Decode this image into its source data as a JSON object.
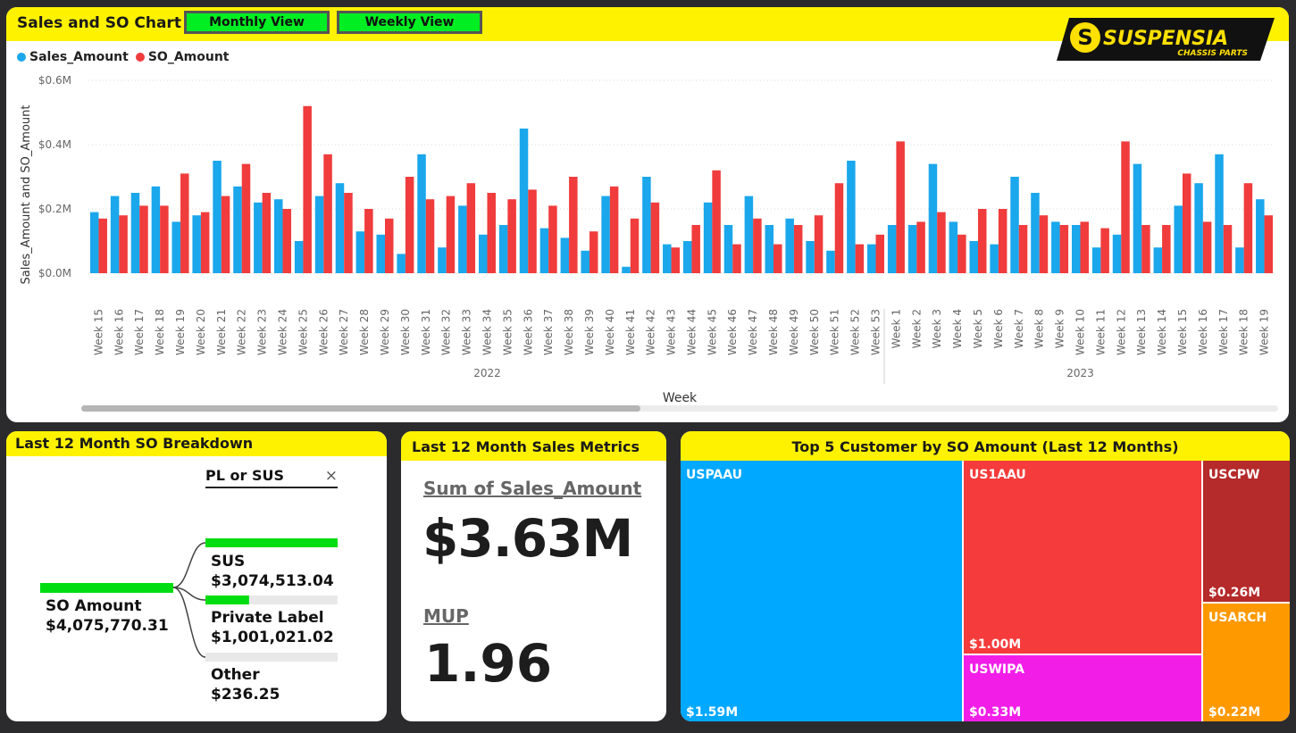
{
  "top": {
    "title": "Sales and SO Chart",
    "buttons": {
      "monthly": "Monthly View",
      "weekly": "Weekly View"
    },
    "logo": {
      "brand": "SUSPENSIA",
      "tagline": "CHASSIS PARTS"
    }
  },
  "chart_data": {
    "type": "bar",
    "title": "Sales and SO Chart",
    "xlabel": "Week",
    "ylabel": "Sales_Amount and SO_Amount",
    "ylim": [
      0,
      0.6
    ],
    "yticks": [
      "$0.0M",
      "$0.2M",
      "$0.4M",
      "$0.6M"
    ],
    "yunit": "$M",
    "grid": true,
    "legend_position": "top-left",
    "colors": {
      "Sales_Amount": "#1aa7ec",
      "SO_Amount": "#f03c3c"
    },
    "categories": [
      "Week 15",
      "Week 16",
      "Week 17",
      "Week 18",
      "Week 19",
      "Week 20",
      "Week 21",
      "Week 22",
      "Week 23",
      "Week 24",
      "Week 25",
      "Week 26",
      "Week 27",
      "Week 28",
      "Week 29",
      "Week 30",
      "Week 31",
      "Week 32",
      "Week 33",
      "Week 34",
      "Week 35",
      "Week 36",
      "Week 37",
      "Week 38",
      "Week 39",
      "Week 40",
      "Week 41",
      "Week 42",
      "Week 43",
      "Week 44",
      "Week 45",
      "Week 46",
      "Week 47",
      "Week 48",
      "Week 49",
      "Week 50",
      "Week 51",
      "Week 52",
      "Week 53",
      "Week 1",
      "Week 2",
      "Week 3",
      "Week 4",
      "Week 5",
      "Week 6",
      "Week 7",
      "Week 8",
      "Week 9",
      "Week 10",
      "Week 11",
      "Week 12",
      "Week 13",
      "Week 14",
      "Week 15",
      "Week 16",
      "Week 17",
      "Week 18",
      "Week 19"
    ],
    "year_groups": [
      {
        "label": "2022",
        "count": 39
      },
      {
        "label": "2023",
        "count": 19
      }
    ],
    "series": [
      {
        "name": "Sales_Amount",
        "values": [
          0.19,
          0.24,
          0.25,
          0.27,
          0.16,
          0.18,
          0.35,
          0.27,
          0.22,
          0.23,
          0.1,
          0.24,
          0.28,
          0.13,
          0.12,
          0.06,
          0.37,
          0.08,
          0.21,
          0.12,
          0.15,
          0.45,
          0.14,
          0.11,
          0.07,
          0.24,
          0.02,
          0.3,
          0.09,
          0.1,
          0.22,
          0.15,
          0.24,
          0.15,
          0.17,
          0.1,
          0.07,
          0.35,
          0.09,
          0.15,
          0.15,
          0.34,
          0.16,
          0.1,
          0.09,
          0.3,
          0.25,
          0.16,
          0.15,
          0.08,
          0.12,
          0.34,
          0.08,
          0.21,
          0.28,
          0.37,
          0.08,
          0.23
        ]
      },
      {
        "name": "SO_Amount",
        "values": [
          0.17,
          0.18,
          0.21,
          0.21,
          0.31,
          0.19,
          0.24,
          0.34,
          0.25,
          0.2,
          0.52,
          0.37,
          0.25,
          0.2,
          0.17,
          0.3,
          0.23,
          0.24,
          0.28,
          0.25,
          0.23,
          0.26,
          0.21,
          0.3,
          0.13,
          0.27,
          0.17,
          0.22,
          0.08,
          0.15,
          0.32,
          0.09,
          0.17,
          0.09,
          0.15,
          0.18,
          0.28,
          0.09,
          0.12,
          0.41,
          0.16,
          0.19,
          0.12,
          0.2,
          0.2,
          0.15,
          0.18,
          0.15,
          0.16,
          0.14,
          0.41,
          0.15,
          0.15,
          0.31,
          0.16,
          0.15,
          0.28,
          0.18
        ]
      }
    ]
  },
  "breakdown": {
    "title": "Last 12 Month SO Breakdown",
    "filter_label": "PL or SUS",
    "close_glyph": "×",
    "root": {
      "label": "SO Amount",
      "value": "$4,075,770.31"
    },
    "children": [
      {
        "label": "SUS",
        "value": "$3,074,513.04",
        "fraction": 1.0
      },
      {
        "label": "Private Label",
        "value": "$1,001,021.02",
        "fraction": 0.33
      },
      {
        "label": "Other",
        "value": "$236.25",
        "fraction": 0.0
      }
    ],
    "bar_color": "#00dd11"
  },
  "metrics": {
    "title": "Last 12 Month Sales Metrics",
    "sales_label": "Sum of Sales_Amount",
    "sales_value": "$3.63M",
    "mup_label": "MUP",
    "mup_value": "1.96"
  },
  "customers": {
    "title": "Top 5 Customer by SO Amount (Last 12 Months)",
    "items": [
      {
        "name": "USPAAU",
        "value": "$1.59M",
        "color": "#00a8ff"
      },
      {
        "name": "US1AAU",
        "value": "$1.00M",
        "color": "#f53b3b"
      },
      {
        "name": "USWIPA",
        "value": "$0.33M",
        "color": "#f21ee8"
      },
      {
        "name": "USCPW",
        "value": "$0.26M",
        "color": "#b52a2a"
      },
      {
        "name": "USARCH",
        "value": "$0.22M",
        "color": "#ff9900"
      }
    ]
  }
}
